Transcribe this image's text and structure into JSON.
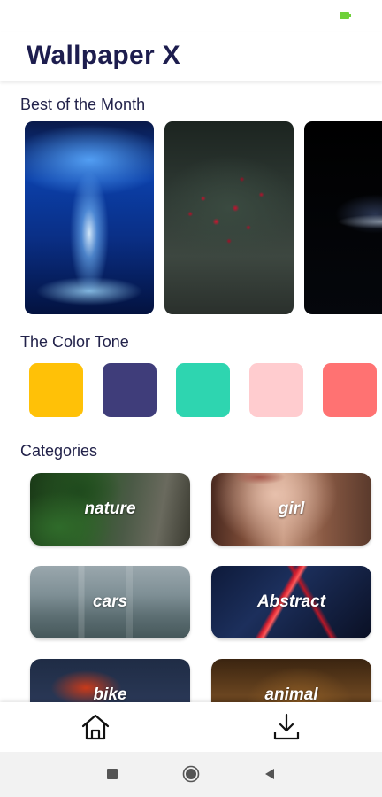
{
  "app": {
    "title": "Wallpaper X"
  },
  "status_bar": {
    "battery_color": "#6fd13a"
  },
  "best_of_month": {
    "title": "Best of the Month",
    "wallpapers": [
      {
        "subject": "blue water fountain"
      },
      {
        "subject": "red berries on leaves"
      },
      {
        "subject": "dark car headlight"
      }
    ]
  },
  "color_tone": {
    "title": "The Color Tone",
    "swatches": [
      {
        "color": "#FFC107"
      },
      {
        "color": "#3F3D7A"
      },
      {
        "color": "#2ED5B0"
      },
      {
        "color": "#FFCCCF"
      },
      {
        "color": "#FF7272"
      }
    ]
  },
  "categories": {
    "title": "Categories",
    "items": [
      {
        "label": "nature"
      },
      {
        "label": "girl"
      },
      {
        "label": "cars"
      },
      {
        "label": "Abstract"
      },
      {
        "label": "bike"
      },
      {
        "label": "animal"
      }
    ]
  },
  "bottom_nav": {
    "items": [
      {
        "icon": "home-icon"
      },
      {
        "icon": "download-icon"
      }
    ]
  },
  "system_nav": {
    "buttons": [
      {
        "icon": "recents-square-icon"
      },
      {
        "icon": "home-circle-icon"
      },
      {
        "icon": "back-triangle-icon"
      }
    ]
  }
}
